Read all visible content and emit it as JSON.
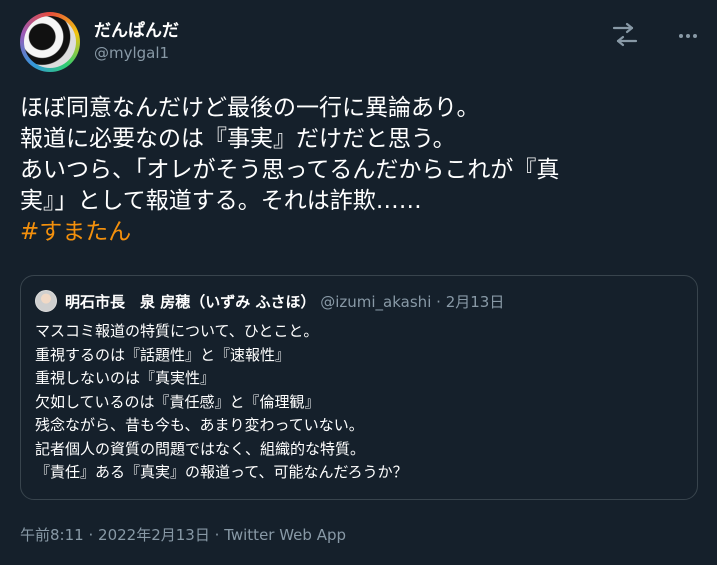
{
  "author": {
    "display_name": "だんぱんだ",
    "handle": "@mylgal1"
  },
  "icons": {
    "share": "share-arrows-icon",
    "more": "more-dots-icon"
  },
  "tweet": {
    "lines": [
      "ほぼ同意なんだけど最後の一行に異論あり。",
      "報道に必要なのは『事実』だけだと思う。",
      "あいつら、「オレがそう思ってるんだからこれが『真",
      "実』」として報道する。それは詐欺……"
    ],
    "hashtag": "#すまたん"
  },
  "quote": {
    "name": "明石市長　泉 房穂（いずみ ふさほ）",
    "handle": "@izumi_akashi",
    "separator": "·",
    "date": "2月13日",
    "lines": [
      "マスコミ報道の特質について、ひとこと。",
      "重視するのは『話題性』と『速報性』",
      "重視しないのは『真実性』",
      "欠如しているのは『責任感』と『倫理観』",
      "残念ながら、昔も今も、あまり変わっていない。",
      "記者個人の資質の問題ではなく、組織的な特質。",
      "『責任』ある『真実』の報道って、可能なんだろうか？"
    ]
  },
  "meta": {
    "time": "午前8:11",
    "sep1": "·",
    "date": "2022年2月13日",
    "sep2": "·",
    "app": "Twitter Web App"
  },
  "colors": {
    "background": "#15202b",
    "hashtag": "#f4900c",
    "secondary_text": "#8899a6",
    "border": "#38444d"
  }
}
